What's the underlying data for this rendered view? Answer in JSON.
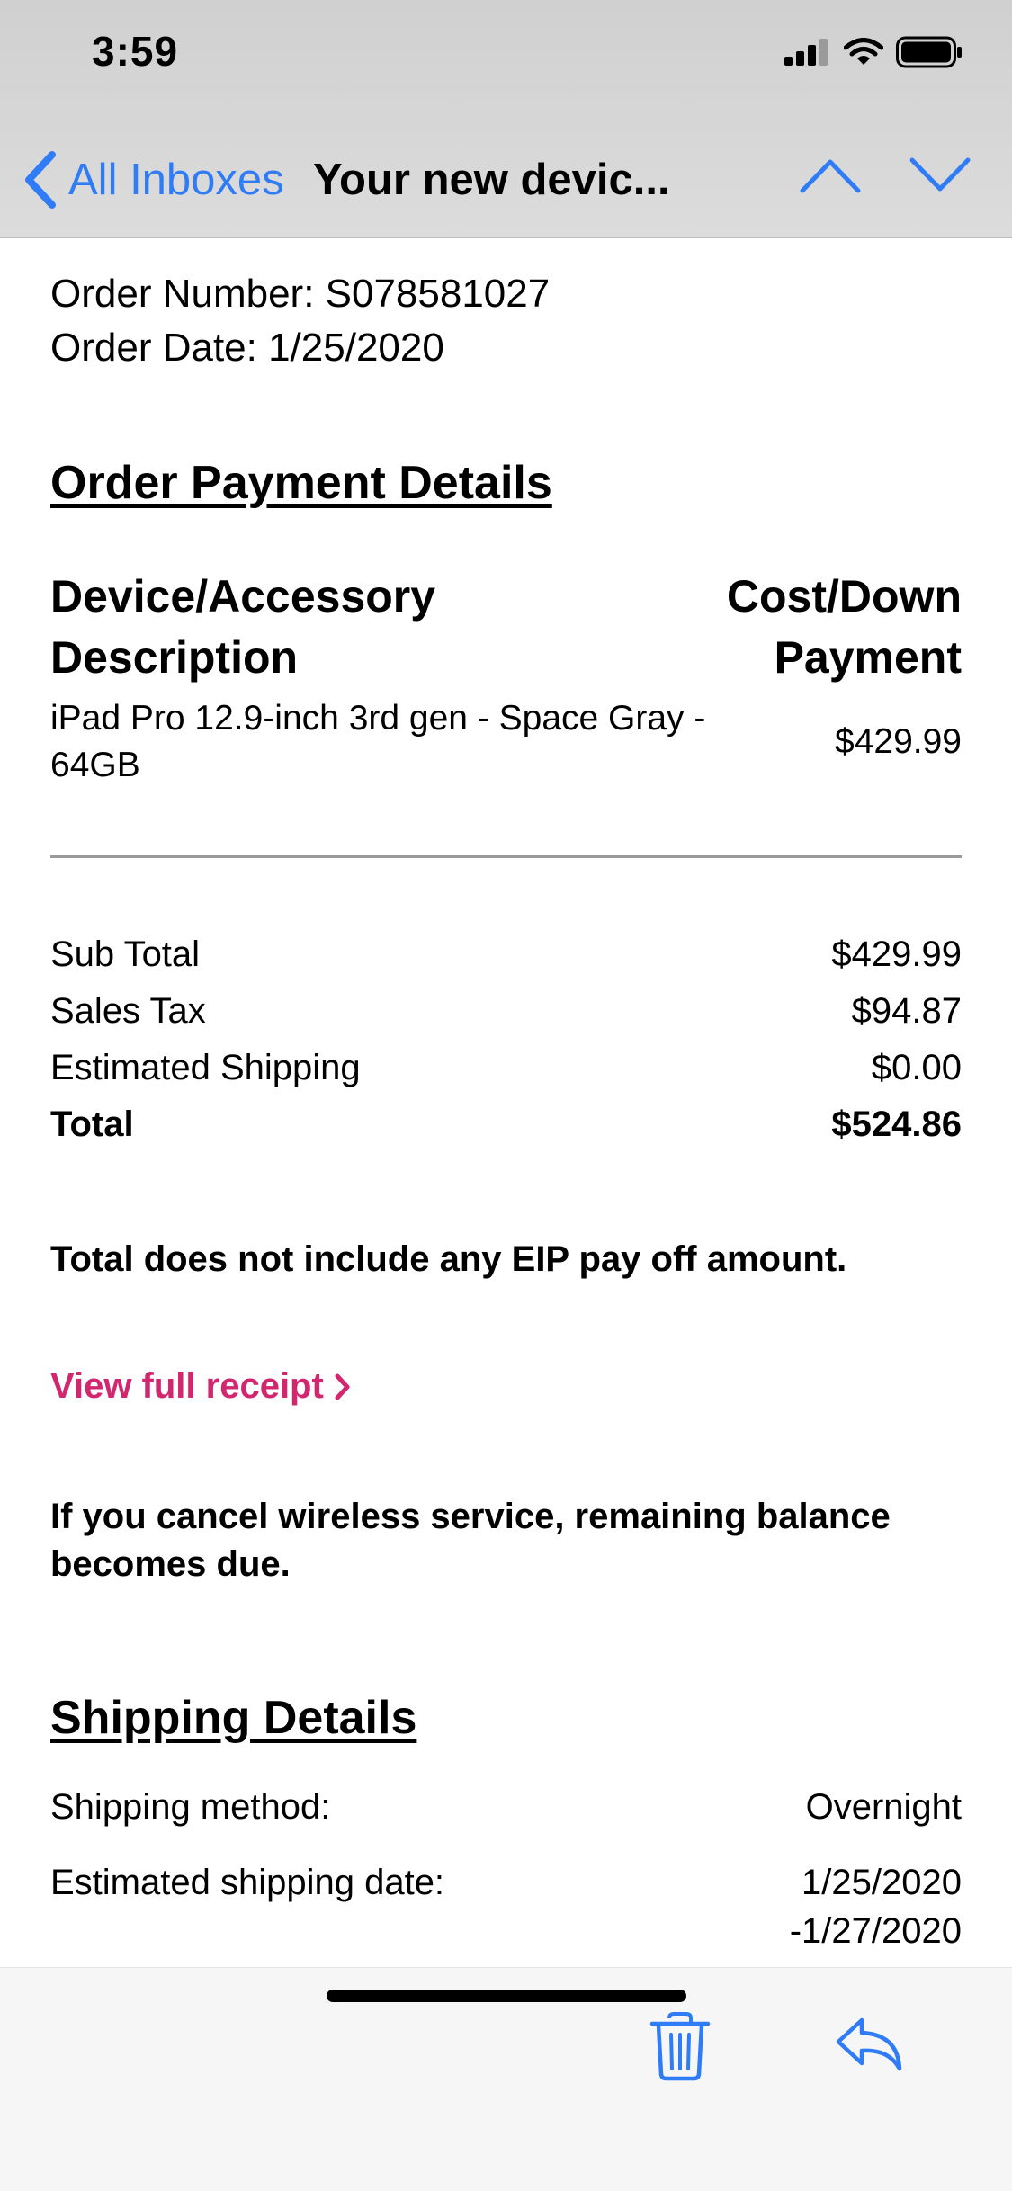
{
  "status_bar": {
    "time": "3:59"
  },
  "nav": {
    "back_label": "All Inboxes",
    "subject": "Your new devic..."
  },
  "order": {
    "number": "Order Number: S078581027",
    "date": "Order Date: 1/25/2020"
  },
  "payment": {
    "title": "Order Payment Details",
    "col_left": [
      "Device/Accessory",
      "Description"
    ],
    "col_right": [
      "Cost/Down",
      "Payment"
    ],
    "item": {
      "description": "iPad Pro 12.9-inch 3rd gen - Space Gray - 64GB",
      "price": "$429.99"
    }
  },
  "totals": [
    {
      "label": "Sub Total",
      "value": "$429.99"
    },
    {
      "label": "Sales Tax",
      "value": "$94.87"
    },
    {
      "label": "Estimated Shipping",
      "value": "$0.00"
    },
    {
      "label": "Total",
      "value": "$524.86"
    }
  ],
  "notes": {
    "eip": "Total does not include any EIP pay off amount.",
    "receipt_link": "View full receipt",
    "cancel": "If you cancel wireless service, remaining balance becomes due."
  },
  "shipping": {
    "title": "Shipping Details",
    "method_label": "Shipping method:",
    "method_value": "Overnight",
    "date_label": "Estimated shipping date:",
    "date_value_1": "1/25/2020",
    "date_value_2": "-1/27/2020"
  },
  "colors": {
    "accent": "#2f7cf6",
    "link": "#d2276f"
  }
}
